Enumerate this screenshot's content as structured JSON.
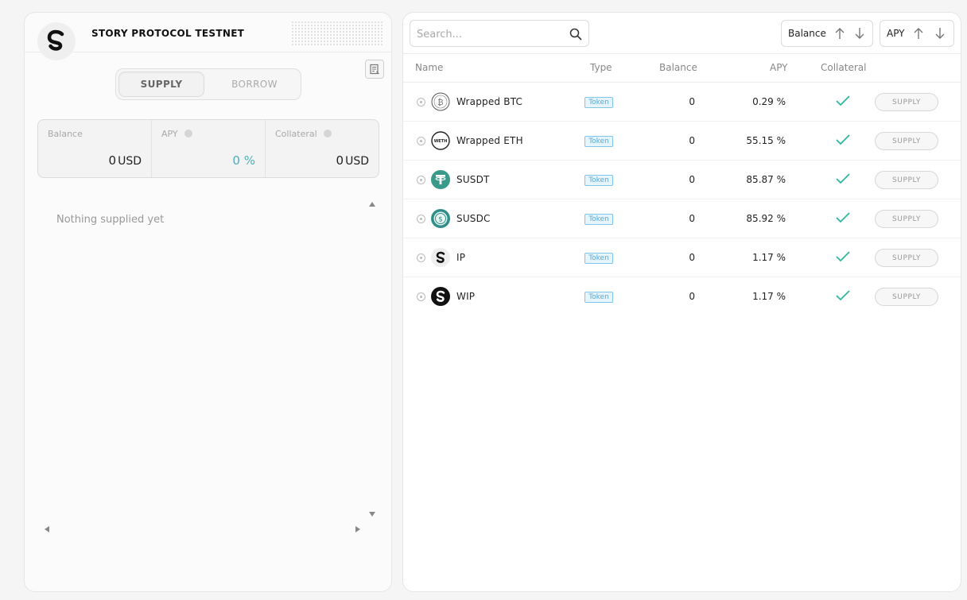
{
  "left": {
    "network_title": "STORY PROTOCOL TESTNET",
    "logo_icon": "story-protocol-logo",
    "toggle": {
      "supply_label": "SUPPLY",
      "borrow_label": "BORROW",
      "active": "SUPPLY"
    },
    "stats": {
      "balance_label": "Balance",
      "balance_value": "0",
      "balance_unit": "USD",
      "apy_label": "APY",
      "apy_value": "0 %",
      "collateral_label": "Collateral",
      "collateral_value": "0",
      "collateral_unit": "USD"
    },
    "empty_message": "Nothing supplied yet"
  },
  "right": {
    "search": {
      "placeholder": "Search..."
    },
    "sort": {
      "balance_label": "Balance",
      "apy_label": "APY"
    },
    "columns": {
      "name": "Name",
      "type": "Type",
      "balance": "Balance",
      "apy": "APY",
      "collateral": "Collateral"
    },
    "rows": [
      {
        "name": "Wrapped BTC",
        "type": "Token",
        "balance": "0",
        "apy": "0.29 %",
        "icon": "wbtc-icon",
        "action": "SUPPLY"
      },
      {
        "name": "Wrapped ETH",
        "type": "Token",
        "balance": "0",
        "apy": "55.15 %",
        "icon": "weth-icon",
        "icon_text": "WETH",
        "action": "SUPPLY"
      },
      {
        "name": "SUSDT",
        "type": "Token",
        "balance": "0",
        "apy": "85.87 %",
        "icon": "tether-icon",
        "action": "SUPPLY"
      },
      {
        "name": "SUSDC",
        "type": "Token",
        "balance": "0",
        "apy": "85.92 %",
        "icon": "usdc-icon",
        "action": "SUPPLY"
      },
      {
        "name": "IP",
        "type": "Token",
        "balance": "0",
        "apy": "1.17 %",
        "icon": "ip-icon",
        "action": "SUPPLY"
      },
      {
        "name": "WIP",
        "type": "Token",
        "balance": "0",
        "apy": "1.17 %",
        "icon": "wip-icon",
        "action": "SUPPLY"
      }
    ]
  },
  "colors": {
    "accent_teal": "#4ab0b8",
    "check_green": "#2fb8a0",
    "tether": "#3a9a8a",
    "token_badge": "#5aa9d6"
  }
}
